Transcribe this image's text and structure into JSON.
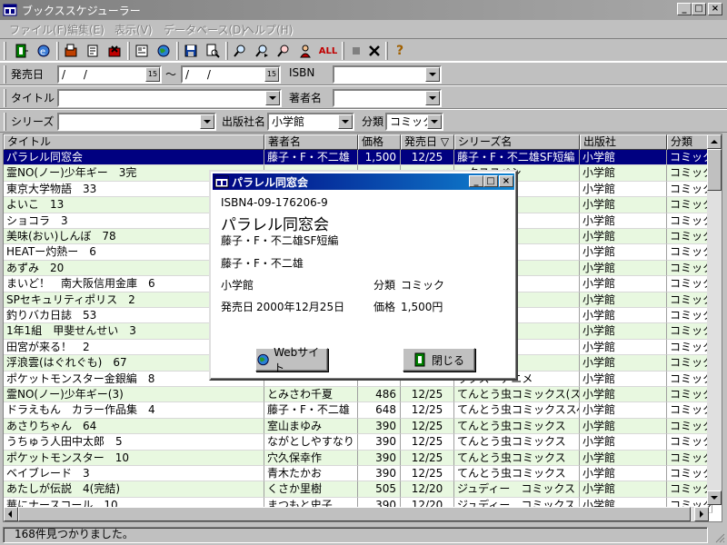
{
  "window": {
    "title": "ブックススケジューラー",
    "min": "_",
    "max": "□",
    "close": "×"
  },
  "menu": [
    "ファイル(F)",
    "編集(E)",
    "表示(V)",
    "データベース(D)",
    "ヘルプ(H)"
  ],
  "toolbar": {
    "all_label": "ALL",
    "help_glyph": "?"
  },
  "filters": {
    "release_label": "発売日",
    "date_from": "/ /",
    "date_tilde": "～",
    "date_to": "/ /",
    "cal_glyph": "15",
    "isbn_label": "ISBN",
    "isbn_value": "",
    "title_label": "タイトル",
    "title_value": "",
    "author_label": "著者名",
    "author_value": "",
    "series_label": "シリーズ",
    "series_value": "",
    "publisher_label": "出版社名",
    "publisher_value": "小学館",
    "category_label": "分類",
    "category_value": "コミック"
  },
  "table": {
    "headers": [
      "タイトル",
      "著者名",
      "価格",
      "発売日 ▽",
      "シリーズ名",
      "出版社",
      "分類"
    ],
    "rows": [
      [
        "パラレル同窓会",
        "藤子・F・不二雄",
        "1,500",
        "12/25",
        "藤子・F・不二雄SF短編",
        "小学館",
        "コミック"
      ],
      [
        "霊NO(ノー)少年ギー　3完",
        "",
        "",
        "",
        "ックススペシ",
        "小学館",
        "コミック"
      ],
      [
        "東京大学物語　33",
        "",
        "",
        "",
        "ス",
        "小学館",
        "コミック"
      ],
      [
        "よいこ　13",
        "",
        "",
        "",
        "ックス",
        "小学館",
        "コミック"
      ],
      [
        "ショコラ　3",
        "",
        "",
        "",
        "ックス",
        "小学館",
        "コミック"
      ],
      [
        "美味(おい)しんぼ　78",
        "",
        "",
        "",
        "ックス",
        "小学館",
        "コミック"
      ],
      [
        "HEATー灼熱ー　6",
        "",
        "",
        "",
        "ックス",
        "小学館",
        "コミック"
      ],
      [
        "あずみ　20",
        "",
        "",
        "",
        "ックス",
        "小学館",
        "コミック"
      ],
      [
        "まいど！　南大阪信用金庫　6",
        "",
        "",
        "",
        "ックス",
        "小学館",
        "コミック"
      ],
      [
        "SPセキュリティポリス　2",
        "",
        "",
        "",
        "ックス",
        "小学館",
        "コミック"
      ],
      [
        "釣りバカ日誌　53",
        "",
        "",
        "",
        "ックス",
        "小学館",
        "コミック"
      ],
      [
        "1年1組　甲斐せんせい　3",
        "",
        "",
        "",
        "ックス",
        "小学館",
        "コミック"
      ],
      [
        "田宮が来る！　2",
        "",
        "",
        "",
        "ックス",
        "小学館",
        "コミック"
      ],
      [
        "浮浪雲(はぐれぐも)　67",
        "",
        "",
        "",
        "ックス",
        "小学館",
        "コミック"
      ],
      [
        "ポケットモンスター金銀編　8",
        "",
        "",
        "",
        "ックス・アニメ",
        "小学館",
        "コミック"
      ],
      [
        "霊NO(ノー)少年ギー(3)",
        "とみさわ千夏",
        "486",
        "12/25",
        "てんとう虫コミックス(スペ",
        "小学館",
        "コミック"
      ],
      [
        "ドラえもん　カラー作品集　4",
        "藤子・F・不二雄",
        "648",
        "12/25",
        "てんとう虫コミックススペシ",
        "小学館",
        "コミック"
      ],
      [
        "あさりちゃん　64",
        "室山まゆみ",
        "390",
        "12/25",
        "てんとう虫コミックス",
        "小学館",
        "コミック"
      ],
      [
        "うちゅう人田中太郎　5",
        "ながとしやすなり",
        "390",
        "12/25",
        "てんとう虫コミックス",
        "小学館",
        "コミック"
      ],
      [
        "ポケットモンスター　10",
        "穴久保幸作",
        "390",
        "12/25",
        "てんとう虫コミックス",
        "小学館",
        "コミック"
      ],
      [
        "ベイブレード　3",
        "青木たかお",
        "390",
        "12/25",
        "てんとう虫コミックス",
        "小学館",
        "コミック"
      ],
      [
        "あたしが伝説　4(完結)",
        "くさか里樹",
        "505",
        "12/20",
        "ジュディー　コミックス",
        "小学館",
        "コミック"
      ],
      [
        "華にナースコール　10",
        "まつもと史子",
        "390",
        "12/20",
        "ジュディー　コミックス",
        "小学館",
        "コミック"
      ]
    ]
  },
  "status": "168件見つかりました。",
  "dialog": {
    "title": "パラレル同窓会",
    "isbn": "ISBN4-09-176206-9",
    "book_title": "パラレル同窓会",
    "series": "藤子・F・不二雄SF短編",
    "author": "藤子・F・不二雄",
    "publisher": "小学館",
    "category_label": "分類",
    "category": "コミック",
    "release_label": "発売日",
    "release": "2000年12月25日",
    "price_label": "価格",
    "price": "1,500円",
    "web_button": "Webサイト",
    "close_button": "閉じる"
  }
}
